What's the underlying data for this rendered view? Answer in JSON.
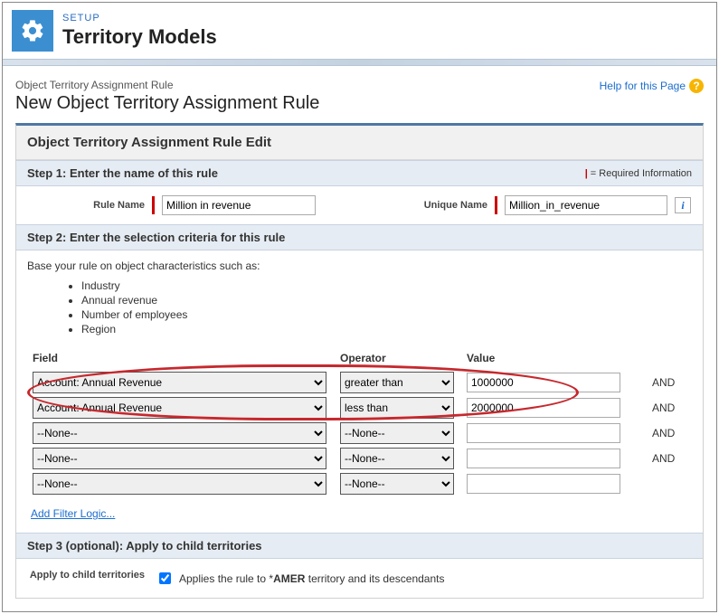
{
  "header": {
    "setup_label": "SETUP",
    "title": "Territory Models"
  },
  "breadcrumb": "Object Territory Assignment Rule",
  "page_subtitle": "New Object Territory Assignment Rule",
  "help_link": "Help for this Page",
  "panel_title": "Object Territory Assignment Rule Edit",
  "step1": {
    "title": "Step 1: Enter the name of this rule",
    "required_info": "= Required Information",
    "rule_name_label": "Rule Name",
    "rule_name_value": "Million in revenue",
    "unique_name_label": "Unique Name",
    "unique_name_value": "Million_in_revenue"
  },
  "step2": {
    "title": "Step 2: Enter the selection criteria for this rule",
    "hint": "Base your rule on object characteristics such as:",
    "char_list": [
      "Industry",
      "Annual revenue",
      "Number of employees",
      "Region"
    ],
    "columns": {
      "field": "Field",
      "operator": "Operator",
      "value": "Value"
    },
    "rows": [
      {
        "field": "Account: Annual Revenue",
        "operator": "greater than",
        "value": "1000000",
        "and": "AND"
      },
      {
        "field": "Account: Annual Revenue",
        "operator": "less than",
        "value": "2000000",
        "and": "AND"
      },
      {
        "field": "--None--",
        "operator": "--None--",
        "value": "",
        "and": "AND"
      },
      {
        "field": "--None--",
        "operator": "--None--",
        "value": "",
        "and": "AND"
      },
      {
        "field": "--None--",
        "operator": "--None--",
        "value": "",
        "and": ""
      }
    ],
    "add_filter": "Add Filter Logic..."
  },
  "step3": {
    "title": "Step 3 (optional): Apply to child territories",
    "label": "Apply to child territories",
    "checkbox_checked": true,
    "text_prefix": "Applies the rule to *",
    "territory": "AMER",
    "text_suffix": " territory and its descendants"
  }
}
